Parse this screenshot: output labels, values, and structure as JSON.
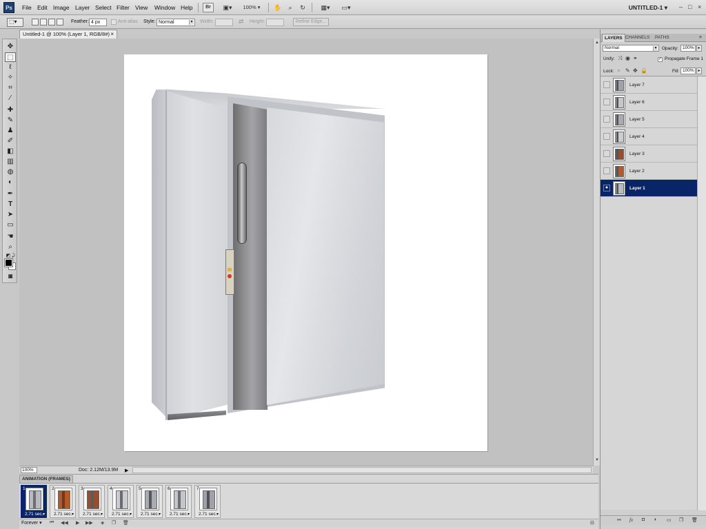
{
  "app": {
    "logo": "Ps",
    "document_title": "UNTITLED-1",
    "document_title_arrow": "▾"
  },
  "menu": [
    "File",
    "Edit",
    "Image",
    "Layer",
    "Select",
    "Filter",
    "View",
    "Window",
    "Help"
  ],
  "menubar_tools": {
    "bridge": "Br",
    "zoom_level": "100%"
  },
  "window_controls": {
    "minimize": "–",
    "restore": "□",
    "close": "×"
  },
  "options": {
    "feather_label": "Feather:",
    "feather_value": "4 px",
    "anti_alias_label": "Anti-alias",
    "style_label": "Style:",
    "style_value": "Normal",
    "width_label": "Width:",
    "height_label": "Height:",
    "refine_edge": "Refine Edge..."
  },
  "document_tab": {
    "label": "Untitled-1 @ 100% (Layer 1, RGB/8#)",
    "close": "×"
  },
  "status": {
    "zoom": "100%",
    "doc_size": "Doc: 2.12M/13.9M",
    "arrow": "▶"
  },
  "animation": {
    "tab": "ANIMATION (FRAMES)",
    "loop": "Forever",
    "loop_arrow": "▾",
    "frames": [
      {
        "num": "1",
        "time": "2.71 sec.",
        "body_color": "#b8bcc2",
        "strip_color": "#6e6e72"
      },
      {
        "num": "2",
        "time": "2.71 sec.",
        "body_color": "#b5582a",
        "strip_color": "#6e3a1c"
      },
      {
        "num": "3",
        "time": "2.71 sec.",
        "body_color": "#9a4d2c",
        "strip_color": "#5b5b5e"
      },
      {
        "num": "4",
        "time": "2.71 sec.",
        "body_color": "#c9ccd0",
        "strip_color": "#6b6b6f"
      },
      {
        "num": "5",
        "time": "2.71 sec.",
        "body_color": "#a8acb2",
        "strip_color": "#55575a"
      },
      {
        "num": "6",
        "time": "2.71 sec.",
        "body_color": "#c3c6ca",
        "strip_color": "#6f6f73"
      },
      {
        "num": "7",
        "time": "2.71 sec.",
        "body_color": "#9fa3a9",
        "strip_color": "#4f5154"
      }
    ]
  },
  "layers_panel": {
    "tabs": [
      "LAYERS",
      "CHANNELS",
      "PATHS"
    ],
    "blend_mode": "Normal",
    "opacity_label": "Opacity:",
    "opacity_value": "100%",
    "unify_label": "Unify:",
    "propagate_label": "Propagate Frame 1",
    "lock_label": "Lock:",
    "fill_label": "Fill:",
    "fill_value": "100%",
    "layers": [
      {
        "name": "Layer 7",
        "visible": false,
        "selected": false,
        "body_color": "#9fa3a9"
      },
      {
        "name": "Layer 6",
        "visible": false,
        "selected": false,
        "body_color": "#c3c6ca"
      },
      {
        "name": "Layer 5",
        "visible": false,
        "selected": false,
        "body_color": "#a8acb2"
      },
      {
        "name": "Layer 4",
        "visible": false,
        "selected": false,
        "body_color": "#c9ccd0"
      },
      {
        "name": "Layer 3",
        "visible": false,
        "selected": false,
        "body_color": "#9a4d2c"
      },
      {
        "name": "Layer 2",
        "visible": false,
        "selected": false,
        "body_color": "#b5582a"
      },
      {
        "name": "Layer 1",
        "visible": true,
        "selected": true,
        "body_color": "#b8bcc2"
      }
    ]
  }
}
